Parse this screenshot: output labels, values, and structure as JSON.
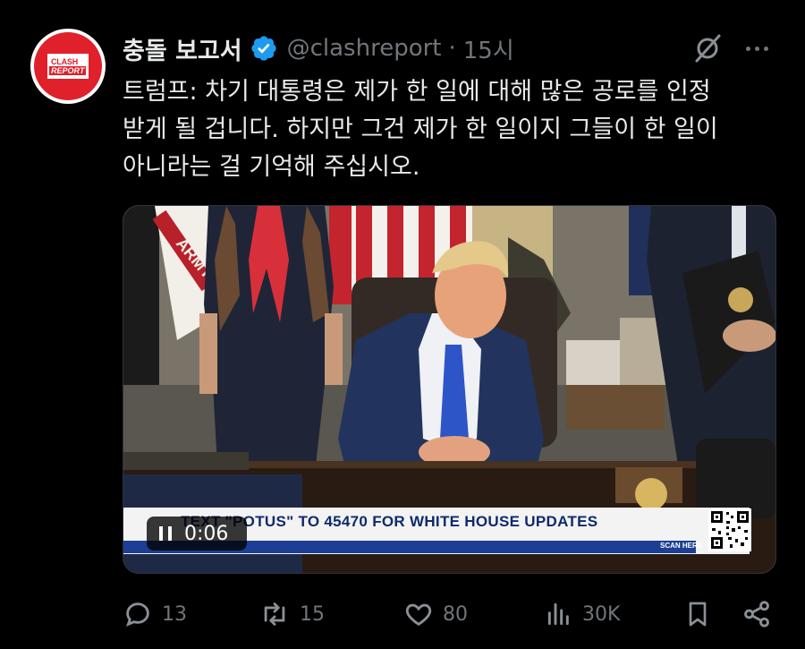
{
  "tweet": {
    "avatar_text_line1": "CLASH",
    "avatar_text_line2": "REPORT",
    "display_name": "충돌 보고서",
    "handle": "@clashreport",
    "separator": "·",
    "time": "15시",
    "text": "트럼프: 차기 대통령은 제가 한 일에 대해 많은 공로를 인정\n받게 될 겁니다. 하지만 그건 제가 한 일이지 그들이 한 일이\n아니라는 걸 기억해 주십시오."
  },
  "media": {
    "banner_text": "TEXT \"POTUS\" TO 45470 FOR WHITE HOUSE UPDATES",
    "banner_scan": "SCAN HERE",
    "video_time": "0:06",
    "scene_flag_text": "ARMY"
  },
  "actions": {
    "replies": "13",
    "reposts": "15",
    "likes": "80",
    "views": "30K"
  },
  "icons": {
    "grok": "grok-icon",
    "more": "more-icon",
    "verified": "verified-badge-icon",
    "reply": "reply-icon",
    "repost": "repost-icon",
    "like": "heart-icon",
    "views": "views-icon",
    "bookmark": "bookmark-icon",
    "share": "share-icon"
  },
  "colors": {
    "background": "#000000",
    "text": "#e7e9ea",
    "secondary": "#71767b",
    "verified": "#1d9bf0",
    "brand_red": "#e0202a"
  }
}
